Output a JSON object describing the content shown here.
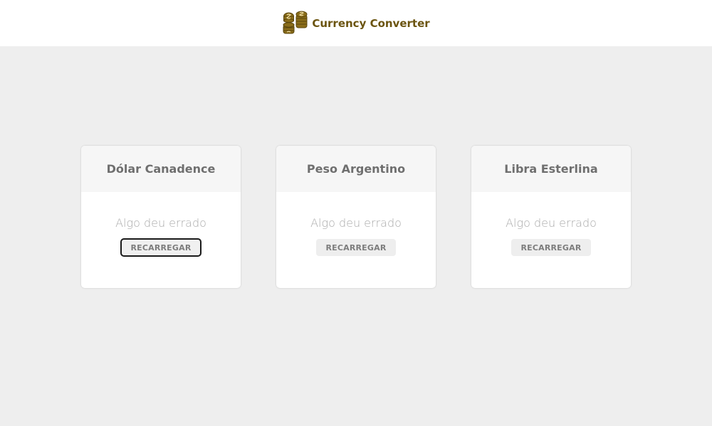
{
  "header": {
    "title": "Currency Converter",
    "logo_icon": "coins-icon",
    "brand_color": "#6b5410"
  },
  "cards": [
    {
      "title": "Dólar Canadence",
      "message": "Algo deu errado",
      "button_label": "RECARREGAR",
      "focused": true
    },
    {
      "title": "Peso Argentino",
      "message": "Algo deu errado",
      "button_label": "RECARREGAR",
      "focused": false
    },
    {
      "title": "Libra Esterlina",
      "message": "Algo deu errado",
      "button_label": "RECARREGAR",
      "focused": false
    }
  ],
  "colors": {
    "page_background": "#eeeeee",
    "card_header": "#f6f6f6",
    "title_text": "#6f6f6f",
    "message_text": "#a9a9a9"
  }
}
